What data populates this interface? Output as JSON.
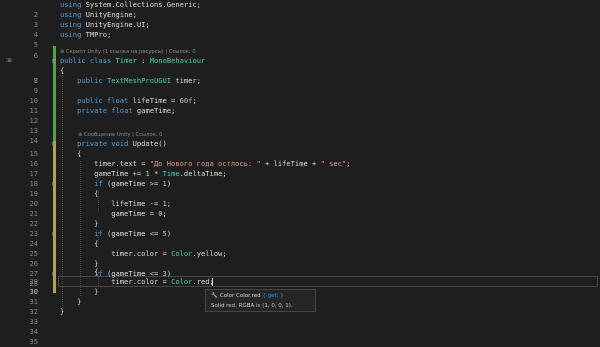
{
  "editor": {
    "lines": [
      {
        "num": "2",
        "text": "using System.Collections.Generic;"
      },
      {
        "num": "3",
        "text": "using UnityEngine;"
      },
      {
        "num": "4",
        "text": "using UnityEngine.UI;"
      },
      {
        "num": "5",
        "text": "using TMPro;"
      },
      {
        "num": "6",
        "text": ""
      },
      {
        "num": "7",
        "text": "public class Timer : MonoBehaviour"
      },
      {
        "num": "8",
        "text": "{"
      },
      {
        "num": "9",
        "text": "    public TextMeshProUGUI timer;"
      },
      {
        "num": "10",
        "text": ""
      },
      {
        "num": "11",
        "text": "    public float lifeTime = 60f;"
      },
      {
        "num": "12",
        "text": "    private float gameTime;"
      },
      {
        "num": "13",
        "text": ""
      },
      {
        "num": "14",
        "text": ""
      },
      {
        "num": "15",
        "text": "    private void Update()"
      },
      {
        "num": "16",
        "text": "    {"
      },
      {
        "num": "17",
        "text": "        timer.text = \"До Нового года остлось: \" + lifeTime + \" sec\";"
      },
      {
        "num": "18",
        "text": "        gameTime += 1 * Time.deltaTime;"
      },
      {
        "num": "19",
        "text": "        if (gameTime >= 1)"
      },
      {
        "num": "20",
        "text": "        {"
      },
      {
        "num": "21",
        "text": "            lifeTime -= 1;"
      },
      {
        "num": "22",
        "text": "            gameTime = 0;"
      },
      {
        "num": "23",
        "text": "        }"
      },
      {
        "num": "24",
        "text": "        if (gameTime <= 5)"
      },
      {
        "num": "25",
        "text": "        {"
      },
      {
        "num": "26",
        "text": "            timer.color = Color.yellow;"
      },
      {
        "num": "27",
        "text": "        }"
      },
      {
        "num": "28",
        "text": "        if (gameTime <= 3)"
      },
      {
        "num": "29",
        "text": "        {"
      },
      {
        "num": "30",
        "text": "            timer.color = Color.red;"
      },
      {
        "num": "31",
        "text": "        }"
      },
      {
        "num": "32",
        "text": "    }"
      },
      {
        "num": "33",
        "text": "}"
      },
      {
        "num": "34",
        "text": ""
      },
      {
        "num": "35",
        "text": ""
      }
    ],
    "codelens": {
      "class": "⊕ Скрипт Unity (1 ссылка на ресурсы) | Ссылок: 0",
      "method": "⊕ Сообщение Unity | Ссылок: 0"
    },
    "gutter_marker": "⁝⊞",
    "fold_glyph": "⊟",
    "active_line": "30"
  },
  "tooltip": {
    "icon": "🔧",
    "signature_type": "Color",
    "signature_name": "Color.red",
    "accessor": "{ get; }",
    "description": "Solid red. RGBA is (1, 0, 0, 1)."
  },
  "colors": {
    "background": "#1e1e1e",
    "keyword": "#569cd6",
    "type": "#4ec9b0",
    "string": "#d69d85",
    "number": "#b5cea8",
    "identifier": "#dcdcdc",
    "change_saved": "#4aa24a",
    "change_unsaved": "#b9a34a"
  }
}
